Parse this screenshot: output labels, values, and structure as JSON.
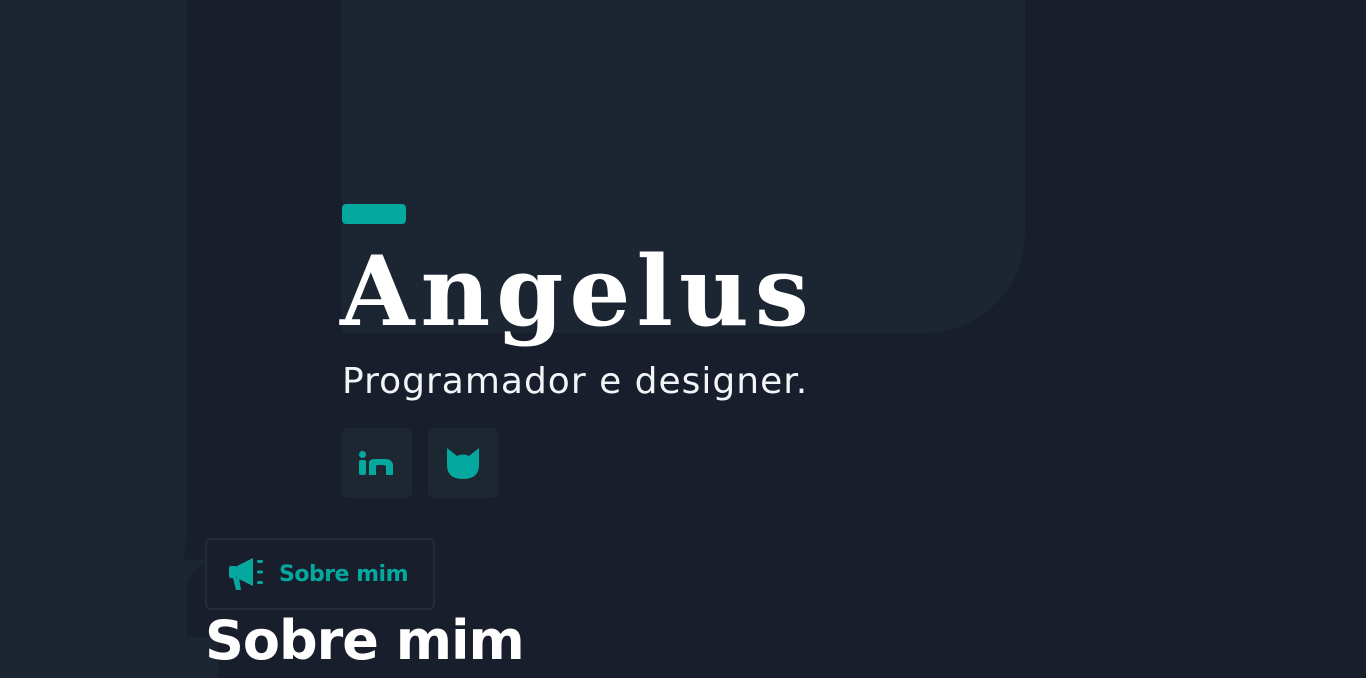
{
  "hero": {
    "title": "Angelus",
    "subtitle": "Programador e designer."
  },
  "social": [
    {
      "name": "LinkedIn",
      "icon": "linkedin-icon"
    },
    {
      "name": "Cat",
      "icon": "cat-icon"
    }
  ],
  "about": {
    "badge_label": "Sobre mim",
    "badge_icon": "megaphone-icon",
    "heading": "Sobre mim"
  },
  "colors": {
    "background": "#181e2b",
    "panel": "#1c2633",
    "accent": "#05a89e",
    "text": "#ffffff"
  }
}
